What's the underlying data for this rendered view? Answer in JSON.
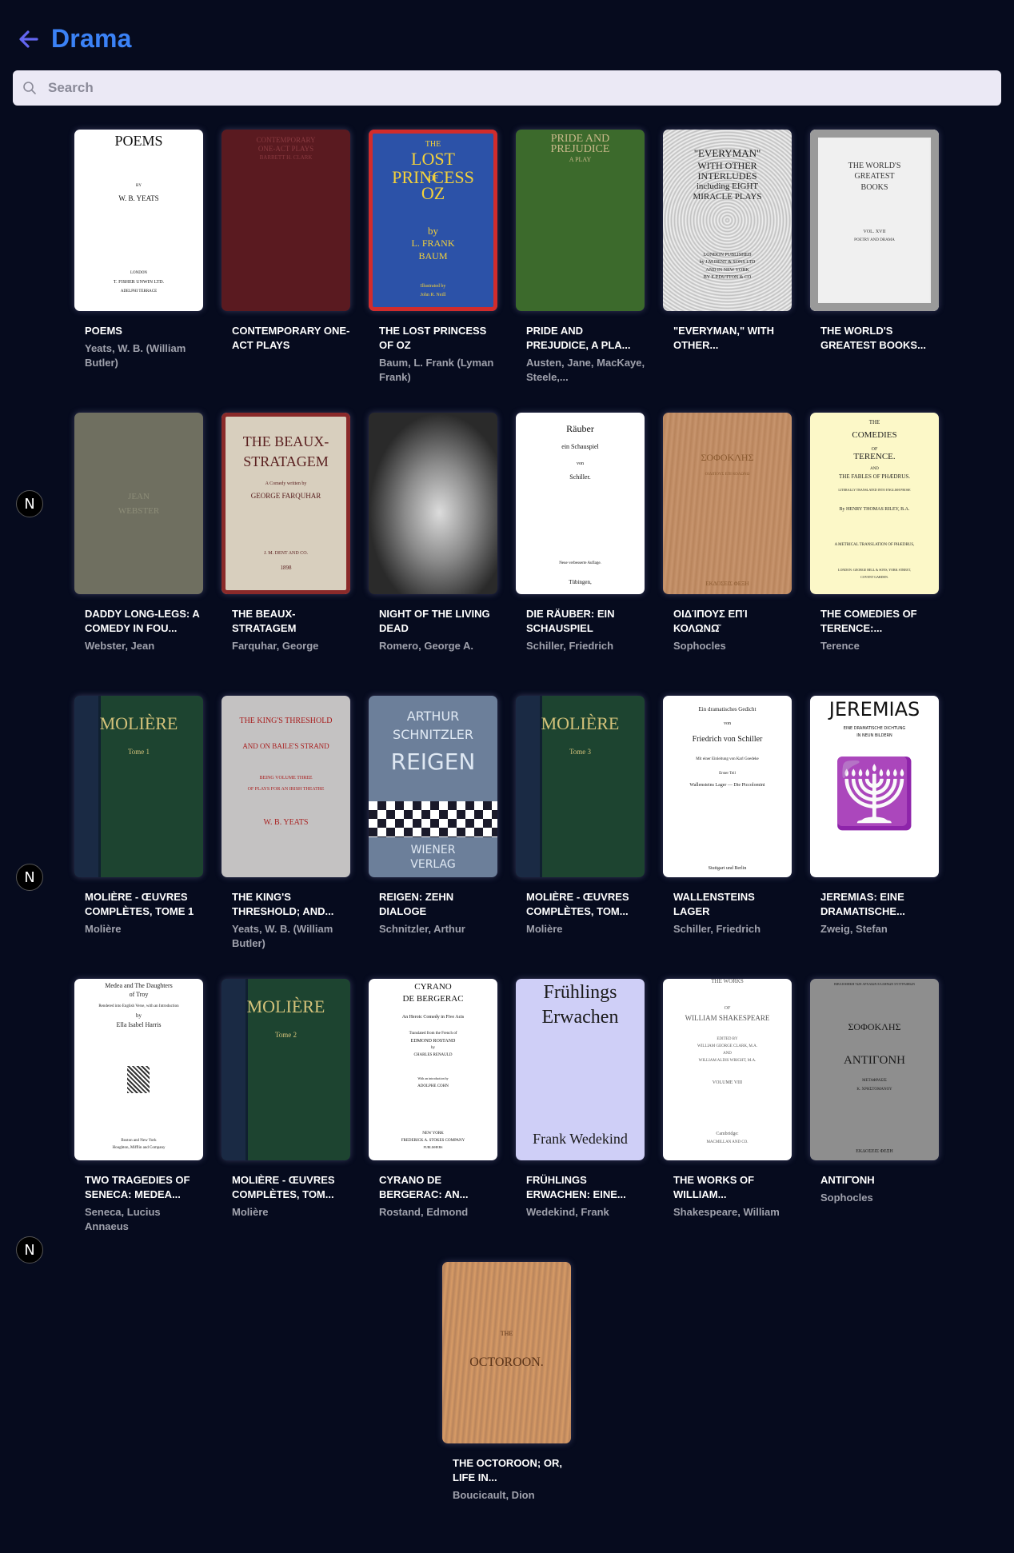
{
  "header": {
    "title": "Drama"
  },
  "search": {
    "placeholder": "Search",
    "value": ""
  },
  "badge_label": "N",
  "books": [
    {
      "title": "POEMS",
      "author": "Yeats, W. B. (William Butler)",
      "cover": {
        "style": "plain-white",
        "lines": [
          "POEMS",
          "BY",
          "W. B. YEATS",
          "LONDON",
          "T. FISHER UNWIN LTD.",
          "ADELPHI TERRACE"
        ]
      }
    },
    {
      "title": "CONTEMPORARY ONE-ACT PLAYS",
      "author": "",
      "cover": {
        "style": "red-cloth",
        "lines": [
          "CONTEMPORARY",
          "ONE-ACT PLAYS",
          "BARRETT H. CLARK"
        ]
      }
    },
    {
      "title": "THE LOST PRINCESS OF OZ",
      "author": "Baum, L. Frank (Lyman Frank)",
      "cover": {
        "style": "oz",
        "lines": [
          "THE",
          "LOST PRINCESS",
          "OF",
          "OZ",
          "by",
          "L. FRANK",
          "BAUM",
          "Illustrated by",
          "John R. Neill"
        ]
      }
    },
    {
      "title": "PRIDE AND PREJUDICE, A PLA...",
      "author": "Austen, Jane, MacKaye, Steele,...",
      "cover": {
        "style": "green-figure",
        "lines": [
          "PRIDE AND",
          "PREJUDICE",
          "A PLAY"
        ]
      }
    },
    {
      "title": "\"EVERYMAN,\" WITH OTHER...",
      "author": "",
      "cover": {
        "style": "ornate-bw",
        "lines": [
          "\"EVERYMAN\"",
          "WITH OTHER",
          "INTERLUDES",
          "including EIGHT",
          "MIRACLE PLAYS",
          "LONDON PUBLISHED",
          "by J.M.DENT & SONS LTD",
          "AND IN NEW YORK",
          "BY E.P.DUTTON & CO"
        ]
      }
    },
    {
      "title": "THE WORLD'S GREATEST BOOKS...",
      "author": "",
      "cover": {
        "style": "ornate-frame",
        "lines": [
          "THE WORLD'S",
          "GREATEST",
          "BOOKS",
          "VOL. XVII",
          "POETRY AND DRAMA"
        ]
      }
    },
    {
      "title": "DADDY LONG-LEGS: A COMEDY IN FOU...",
      "author": "Webster, Jean",
      "cover": {
        "style": "daddy",
        "lines": [
          "JEAN",
          "WEBSTER"
        ]
      }
    },
    {
      "title": "THE BEAUX-STRATAGEM",
      "author": "Farquhar, George",
      "cover": {
        "style": "beaux",
        "lines": [
          "THE BEAUX-",
          "STRATAGEM",
          "A Comedy written by",
          "GEORGE FARQUHAR",
          "J. M. DENT AND CO.",
          "1898"
        ]
      }
    },
    {
      "title": "NIGHT OF THE LIVING DEAD",
      "author": "Romero, George A.",
      "cover": {
        "style": "photo",
        "lines": []
      }
    },
    {
      "title": "DIE RÄUBER: EIN SCHAUSPIEL",
      "author": "Schiller, Friedrich",
      "cover": {
        "style": "fraktur",
        "lines": [
          "Räuber",
          "ein Schauspiel",
          "von",
          "Schiller.",
          "Neue verbesserte Auflage.",
          "Tübingen,"
        ]
      }
    },
    {
      "title": "ΟΙΔΊΠΟΥΣ ΕΠΊ ΚΟΛΩΝΩ͂",
      "author": "Sophocles",
      "cover": {
        "style": "wood",
        "lines": [
          "ΣΟΦΟΚΛΗΣ",
          "ΟΙΔΙΠΟΥΣ ΕΠΙ ΚΟΛΩΝΩ",
          "ΕΚΔΟΣΕΙΣ ΦΕΞΗ"
        ]
      }
    },
    {
      "title": "THE COMEDIES OF TERENCE:...",
      "author": "Terence",
      "cover": {
        "style": "cream",
        "lines": [
          "THE",
          "COMEDIES",
          "OF",
          "TERENCE.",
          "AND",
          "THE FABLES OF PHÆDRUS.",
          "LITERALLY TRANSLATED INTO ENGLISH PROSE",
          "By HENRY THOMAS RILEY, B.A.",
          "A METRICAL TRANSLATION OF PHÆDRUS,",
          "LONDON: GEORGE BELL & SONS, YORK STREET,",
          "COVENT GARDEN."
        ]
      }
    },
    {
      "title": "MOLIÈRE - ŒUVRES COMPLÈTES, TOME 1",
      "author": "Molière",
      "cover": {
        "style": "moliere",
        "lines": [
          "MOLIÈRE",
          "Tome 1"
        ]
      }
    },
    {
      "title": "THE KING'S THRESHOLD; AND...",
      "author": "Yeats, W. B. (William Butler)",
      "cover": {
        "style": "grey-red",
        "lines": [
          "THE KING'S THRESHOLD",
          "AND ON BAILE'S STRAND",
          "BEING VOLUME THREE",
          "OF PLAYS FOR AN IRISH THEATRE",
          "W. B. YEATS"
        ]
      }
    },
    {
      "title": "REIGEN: ZEHN DIALOGE",
      "author": "Schnitzler, Arthur",
      "cover": {
        "style": "reigen",
        "lines": [
          "ARTHUR",
          "SCHNITZLER",
          "REIGEN",
          "WIENER",
          "VERLAG"
        ]
      }
    },
    {
      "title": "MOLIÈRE - ŒUVRES COMPLÈTES, TOM...",
      "author": "Molière",
      "cover": {
        "style": "moliere",
        "lines": [
          "MOLIÈRE",
          "Tome 3"
        ]
      }
    },
    {
      "title": "WALLENSTEINS LAGER",
      "author": "Schiller, Friedrich",
      "cover": {
        "style": "fraktur2",
        "lines": [
          "Ein dramatisches Gedicht",
          "von",
          "Friedrich von Schiller",
          "Mit einer Einleitung von Karl Goedeke",
          "Erster Teil",
          "Wallensteins Lager — Die Piccolomini",
          "Stuttgart und Berlin"
        ]
      }
    },
    {
      "title": "JEREMIAS: EINE DRAMATISCHE...",
      "author": "Zweig, Stefan",
      "cover": {
        "style": "jeremias",
        "lines": [
          "JEREMIAS",
          "EINE DRAMATISCHE DICHTUNG",
          "IN NEUN BILDERN"
        ]
      }
    },
    {
      "title": "TWO TRAGEDIES OF SENECA: MEDEA...",
      "author": "Seneca, Lucius Annaeus",
      "cover": {
        "style": "plain-white2",
        "lines": [
          "Medea and The Daughters",
          "of Troy",
          "Rendered into English Verse, with an Introduction",
          "by",
          "Ella Isabel Harris",
          "Boston and New York",
          "Houghton, Mifflin and Company"
        ]
      }
    },
    {
      "title": "MOLIÈRE - ŒUVRES COMPLÈTES, TOM...",
      "author": "Molière",
      "cover": {
        "style": "moliere",
        "lines": [
          "MOLIÈRE",
          "Tome 2"
        ]
      }
    },
    {
      "title": "CYRANO DE BERGERAC: AN...",
      "author": "Rostand, Edmond",
      "cover": {
        "style": "cyrano",
        "lines": [
          "CYRANO",
          "DE BERGERAC",
          "An Heroic Comedy in Five Acts",
          "Translated from the French of",
          "EDMOND ROSTAND",
          "by",
          "CHARLES RENAULD",
          "With an introduction by",
          "ADOLPHE COHN",
          "NEW YORK",
          "FREDERICK A. STOKES COMPANY",
          "PUBLISHERS"
        ]
      }
    },
    {
      "title": "FRÜHLINGS ERWACHEN: EINE...",
      "author": "Wedekind, Frank",
      "cover": {
        "style": "lavender",
        "lines": [
          "Frühlings",
          "Erwachen",
          "Frank Wedekind"
        ]
      }
    },
    {
      "title": "THE WORKS OF WILLIAM...",
      "author": "Shakespeare, William",
      "cover": {
        "style": "plain-white3",
        "lines": [
          "THE WORKS",
          "OF",
          "WILLIAM SHAKESPEARE",
          "EDITED BY",
          "WILLIAM GEORGE CLARK, M.A.",
          "AND",
          "WILLIAM ALDIS WRIGHT, M.A.",
          "VOLUME VIII",
          "Cambridge:",
          "MACMILLAN AND CO."
        ]
      }
    },
    {
      "title": "ΑΝΤΙΓΌΝΗ",
      "author": "Sophocles",
      "cover": {
        "style": "grey-greek",
        "lines": [
          "ΒΙΒΛΙΟΘΗΚΗ ΤΩΝ ΑΡΧΑΙΩΝ ΕΛΛΗΝΩΝ ΣΥΓΓΡΑΦΕΩΝ",
          "ΣΟΦΟΚΛΗΣ",
          "ΑΝΤΙΓΟΝΗ",
          "ΜΕΤΑΦΡΑΣΙΣ",
          "Κ. ΧΡΗΣΤΟΜΑΝΟΥ",
          "ΕΚΔΟΣΕΙΣ ΦΕΞΗ"
        ]
      }
    },
    {
      "title": "THE OCTOROON; OR, LIFE IN...",
      "author": "Boucicault, Dion",
      "cover": {
        "style": "octoroon",
        "lines": [
          "THE",
          "OCTOROON."
        ]
      }
    }
  ]
}
